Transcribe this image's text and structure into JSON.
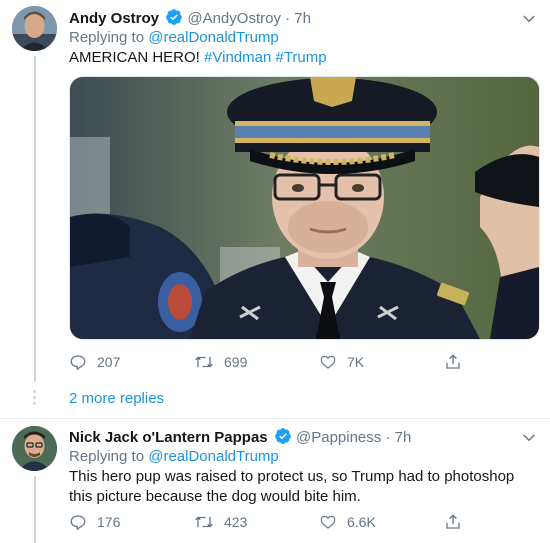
{
  "tweet1": {
    "name": "Andy Ostroy",
    "handle": "@AndyOstroy",
    "separator": "·",
    "time": "7h",
    "replying_label": "Replying to",
    "replying_mention": "@realDonaldTrump",
    "text": "AMERICAN HERO!",
    "hashtags": [
      "#Vindman",
      "#Trump"
    ],
    "actions": {
      "replies": "207",
      "retweets": "699",
      "likes": "7K"
    }
  },
  "more_replies": "2 more replies",
  "tweet2": {
    "name": "Nick Jack o'Lantern Pappas",
    "handle": "@Pappiness",
    "separator": "·",
    "time": "7h",
    "replying_label": "Replying to",
    "replying_mention": "@realDonaldTrump",
    "text": "This hero pup was raised to protect us, so Trump had to photoshop this picture because the dog would bite him.",
    "actions": {
      "replies": "176",
      "retweets": "423",
      "likes": "6.6K"
    }
  },
  "colors": {
    "accent": "#1b95e0",
    "muted": "#657786",
    "verified": "#1da1f2"
  },
  "icons": [
    "verified-badge-icon",
    "chevron-down-icon",
    "reply-icon",
    "retweet-icon",
    "like-icon",
    "share-icon"
  ]
}
